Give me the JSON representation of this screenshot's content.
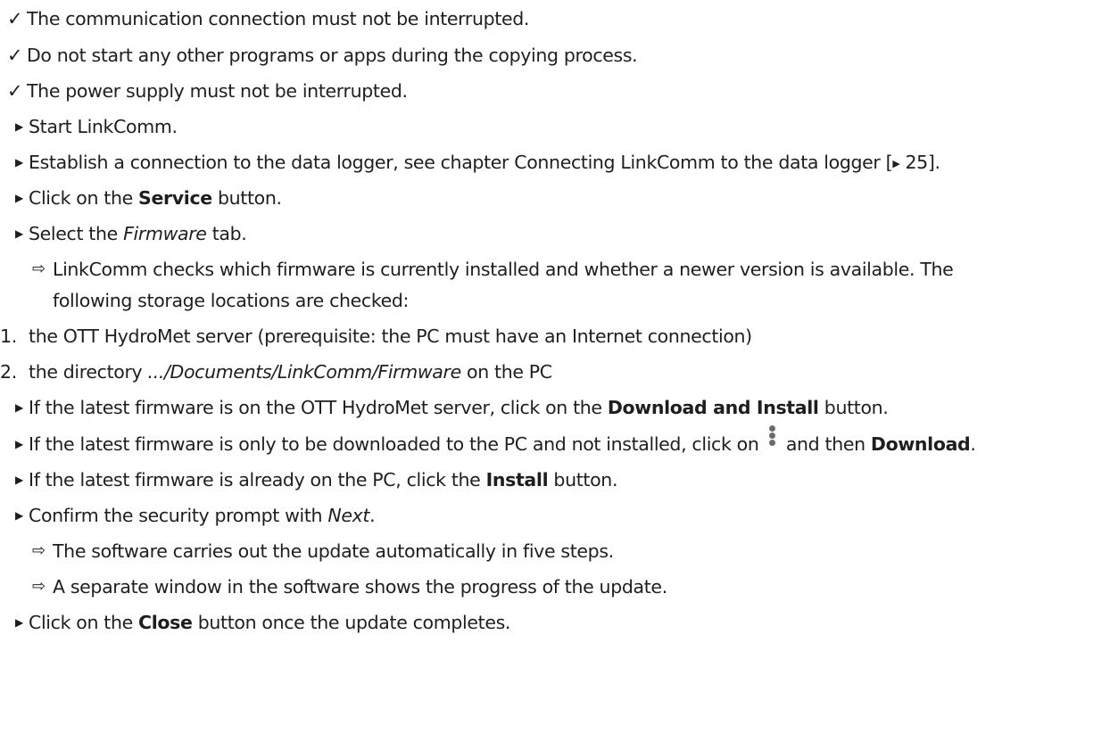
{
  "symbols": {
    "check": "✓",
    "step": "▶",
    "result": "⇨",
    "ref_arrow": "▶"
  },
  "checks": [
    "The communication connection must not be interrupted.",
    "Do not start any other programs or apps during the copying process.",
    "The power supply must not be interrupted."
  ],
  "steps_a": {
    "start": "Start LinkComm.",
    "connect_pre": "Establish a connection to the data logger, see chapter Connecting LinkComm to the data logger [",
    "connect_page": "25",
    "connect_post": "].",
    "service_pre": "Click on the ",
    "service_bold": "Service",
    "service_post": " button.",
    "firmware_pre": "Select the ",
    "firmware_italic": "Firmware",
    "firmware_post": " tab."
  },
  "result_check": {
    "line1": "LinkComm checks which firmware is currently installed and whether a newer version is available. The",
    "line2": "following storage locations are checked:"
  },
  "locations": [
    {
      "num": "1.",
      "text": "the OTT HydroMet server (prerequisite: the PC must have an Internet connection)"
    },
    {
      "num": "2.",
      "pre": "the directory ",
      "italic": ".../Documents/LinkComm/Firmware",
      "post": " on the PC"
    }
  ],
  "steps_b": {
    "download_install_pre": "If the latest firmware is on the OTT HydroMet server, click on the ",
    "download_install_bold": "Download and Install",
    "download_install_post": " button.",
    "download_pre": "If the latest firmware is only to be downloaded to the PC and not installed, click on ",
    "download_mid": " and then ",
    "download_bold": "Download",
    "download_post": ".",
    "install_pre": "If the latest firmware is already on the PC, click the ",
    "install_bold": "Install",
    "install_post": " button.",
    "confirm_pre": "Confirm the security prompt with ",
    "confirm_italic": "Next",
    "confirm_post": "."
  },
  "results_update": [
    "The software carries out the update automatically in five steps.",
    "A separate window in the software shows the progress of the update."
  ],
  "step_close": {
    "pre": "Click on the ",
    "bold": "Close",
    "post": " button once the update completes."
  }
}
